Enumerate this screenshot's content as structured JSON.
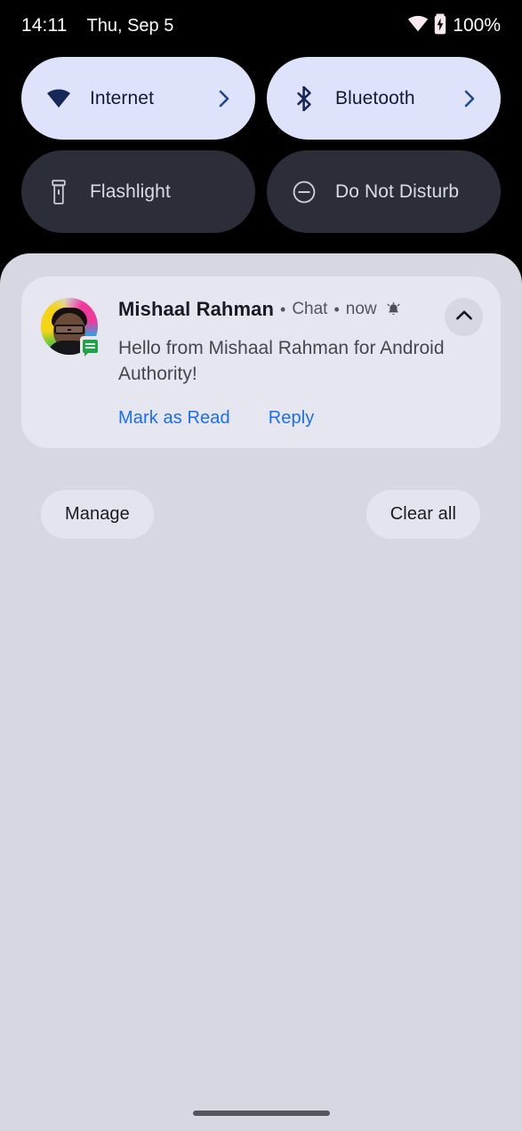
{
  "status_bar": {
    "time": "14:11",
    "date": "Thu, Sep 5",
    "battery_percent": "100%",
    "wifi_icon": "wifi-icon",
    "battery_icon": "battery-charging-icon"
  },
  "quick_settings": {
    "tiles": [
      {
        "label": "Internet",
        "icon": "wifi-icon",
        "state": "active",
        "has_chevron": true
      },
      {
        "label": "Bluetooth",
        "icon": "bluetooth-icon",
        "state": "active",
        "has_chevron": true
      },
      {
        "label": "Flashlight",
        "icon": "flashlight-icon",
        "state": "inactive",
        "has_chevron": false
      },
      {
        "label": "Do Not Disturb",
        "icon": "do-not-disturb-icon",
        "state": "inactive",
        "has_chevron": false
      }
    ]
  },
  "notification": {
    "sender": "Mishaal Rahman",
    "separator_1": "•",
    "channel": "Chat",
    "separator_2": "•",
    "time": "now",
    "alert_icon": "bell-ringing-icon",
    "message": "Hello from Mishaal Rahman for Android Authority!",
    "actions": [
      {
        "label": "Mark as Read"
      },
      {
        "label": "Reply"
      }
    ],
    "collapse_icon": "chevron-up-icon",
    "app_badge_icon": "message-bubble-icon",
    "avatar": "contact-avatar"
  },
  "shade_footer": {
    "manage_label": "Manage",
    "clear_all_label": "Clear all"
  },
  "navigation": {
    "handle": "gesture-nav-handle"
  },
  "colors": {
    "screen_background": "#000000",
    "shade_background": "#d7d7e2",
    "notification_card": "#e6e6f0",
    "tile_active_bg": "#dfe2fb",
    "tile_active_fg": "#121c36",
    "tile_inactive_bg": "#2b2e38",
    "tile_inactive_fg": "#dadce4",
    "action_link": "#1b6ef3",
    "footer_pill": "#e4e4ee"
  }
}
